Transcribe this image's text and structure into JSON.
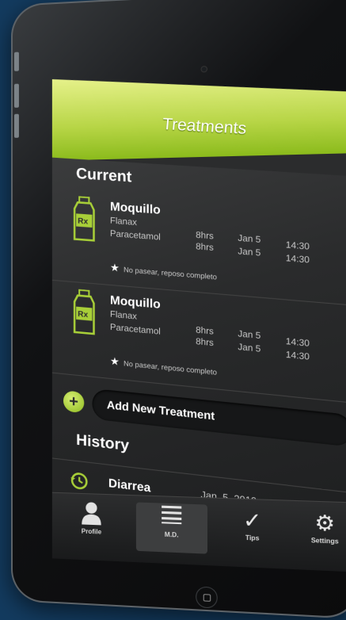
{
  "app": {
    "title": "Treatments"
  },
  "current": {
    "heading": "Current",
    "items": [
      {
        "name": "Moquillo",
        "meds": [
          {
            "drug": "Flanax",
            "interval": "",
            "date": "",
            "time": ""
          },
          {
            "drug": "Paracetamol",
            "interval": "8hrs",
            "date": "Jan 5",
            "time": "14:30"
          }
        ],
        "extra_row": {
          "interval": "8hrs",
          "date": "Jan 5",
          "time": "14:30"
        },
        "note": "No pasear, reposo completo"
      },
      {
        "name": "Moquillo",
        "meds": [
          {
            "drug": "Flanax",
            "interval": "",
            "date": "",
            "time": ""
          },
          {
            "drug": "Paracetamol",
            "interval": "8hrs",
            "date": "Jan 5",
            "time": "14:30"
          }
        ],
        "extra_row": {
          "interval": "8hrs",
          "date": "Jan 5",
          "time": "14:30"
        },
        "note": "No pasear, reposo completo"
      }
    ]
  },
  "add_treatment": {
    "label": "Add New Treatment",
    "icon": "plus-circle-icon"
  },
  "history": {
    "heading": "History",
    "items": [
      {
        "name": "Diarrea",
        "date": "Jan. 5, 2010",
        "icon": "history-clock-icon"
      }
    ]
  },
  "tabbar": {
    "tabs": [
      {
        "label": "Profile",
        "icon": "person-icon",
        "active": false
      },
      {
        "label": "M.D.",
        "icon": "list-icon",
        "active": true
      },
      {
        "label": "Tips",
        "icon": "checkmark-icon",
        "active": false
      },
      {
        "label": "Settings",
        "icon": "gear-icon",
        "active": false
      }
    ]
  },
  "colors": {
    "accent": "#a8cf38",
    "background": "#123a5e",
    "screen": "#2b2c2d"
  },
  "chevron": "›",
  "star": "★"
}
